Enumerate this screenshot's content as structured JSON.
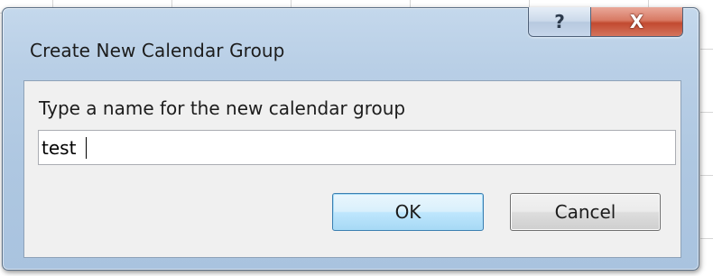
{
  "dialog": {
    "title": "Create New Calendar Group",
    "help_glyph": "?",
    "close_glyph": "X"
  },
  "form": {
    "prompt": "Type a name for the new calendar group",
    "name_value": "test"
  },
  "buttons": {
    "ok_label": "OK",
    "cancel_label": "Cancel"
  },
  "colors": {
    "ok_border": "#3c7fb1",
    "close_button": "#c24a30",
    "dialog_frame": "#b9cfe6"
  }
}
